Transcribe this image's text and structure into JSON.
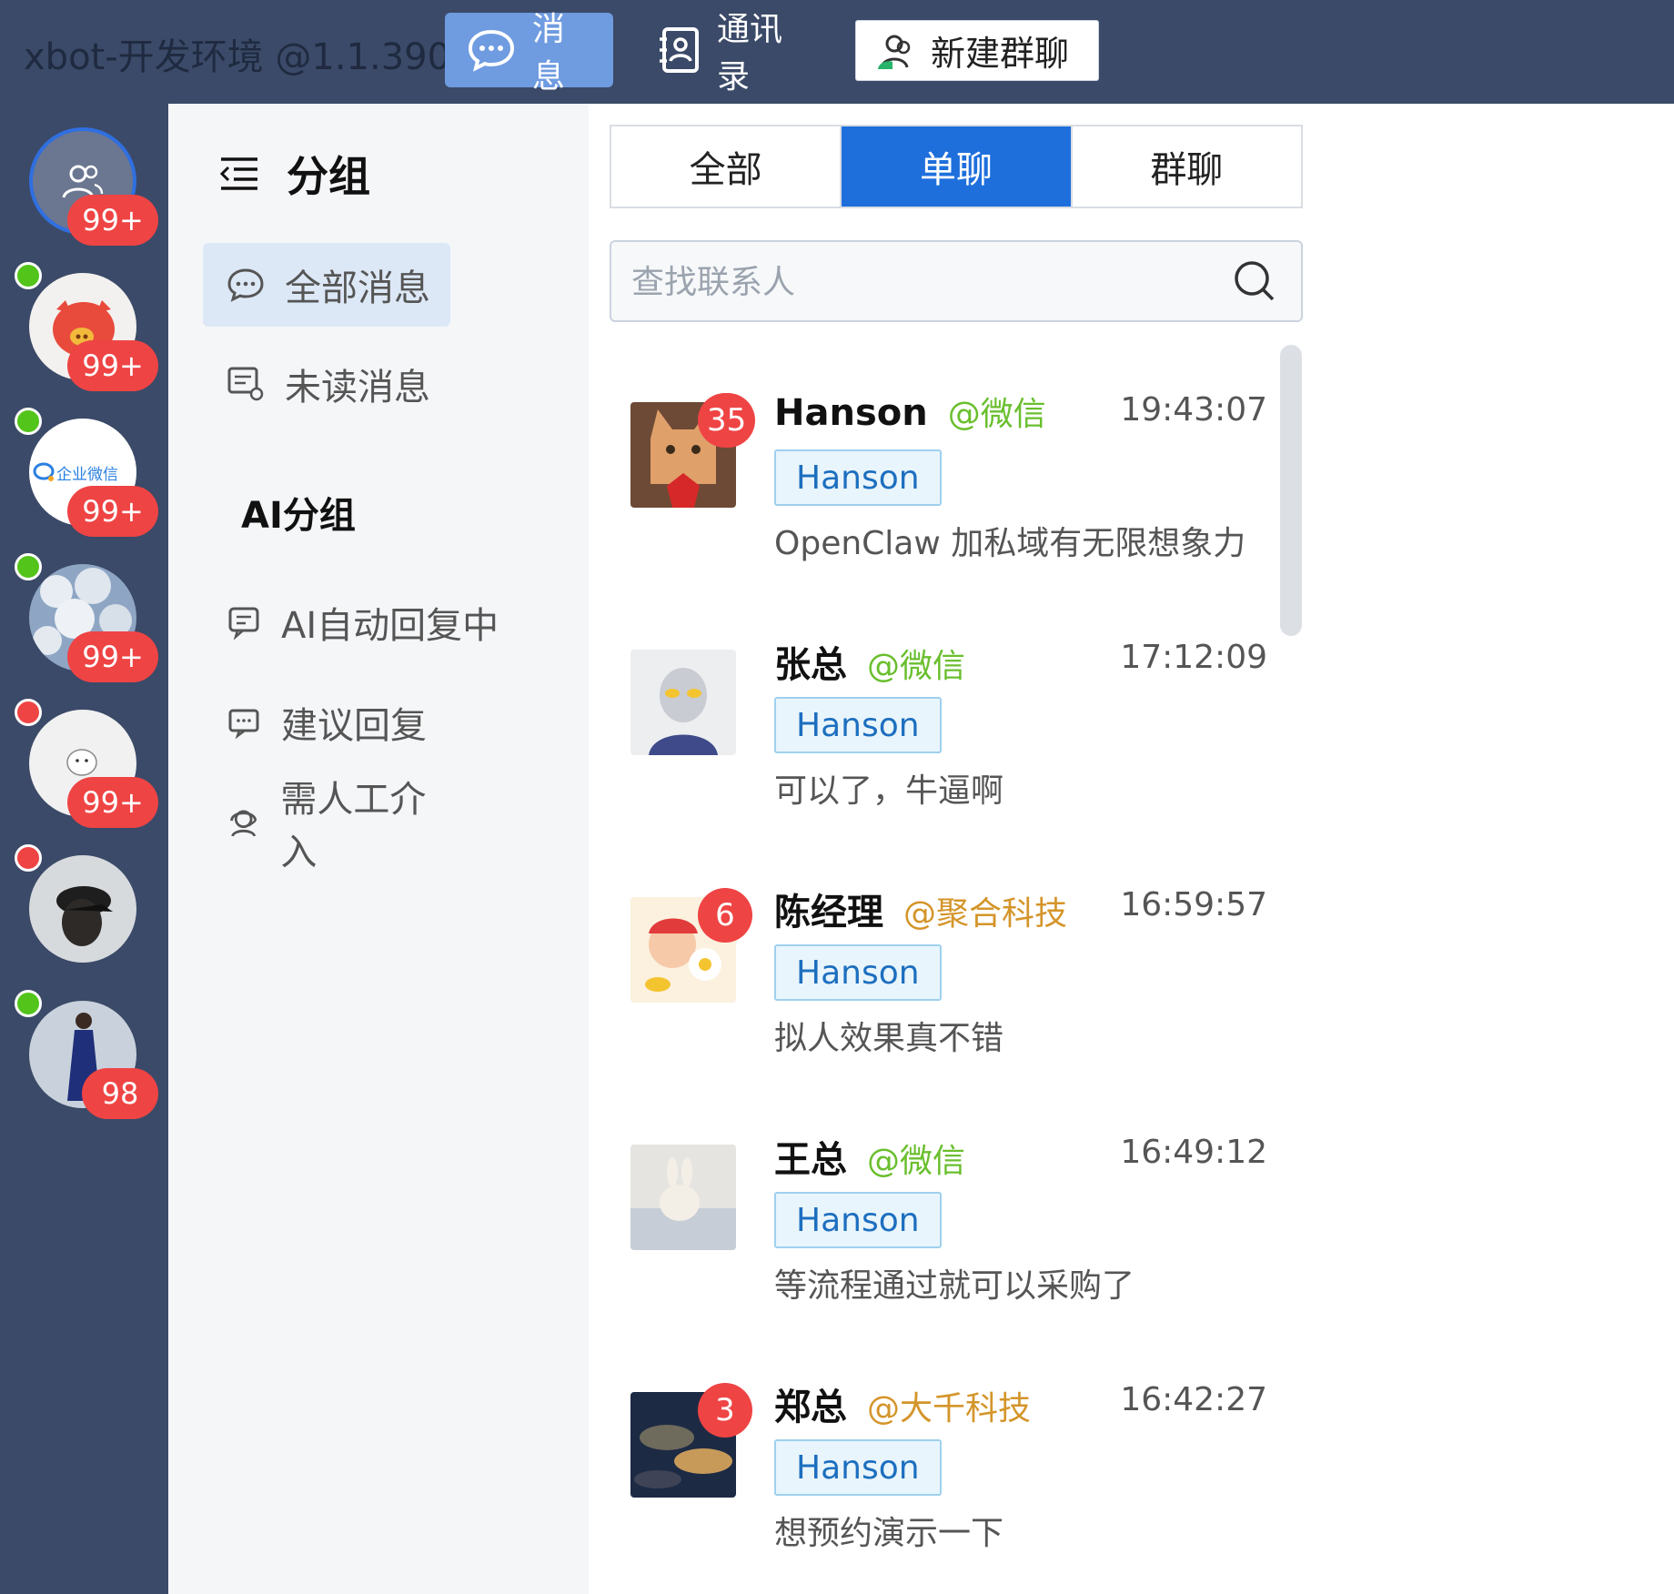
{
  "app": {
    "title": "xbot-开发环境 @1.1.390"
  },
  "nav": {
    "messages_label": "消息",
    "contacts_label": "通讯录",
    "new_group_label": "新建群聊"
  },
  "accounts": [
    {
      "badge": "99+",
      "status": "none"
    },
    {
      "badge": "99+",
      "status": "online"
    },
    {
      "badge": "99+",
      "status": "online",
      "logo_text": "企业微信"
    },
    {
      "badge": "99+",
      "status": "online"
    },
    {
      "badge": "99+",
      "status": "offline"
    },
    {
      "badge": "",
      "status": "offline"
    },
    {
      "badge": "98",
      "status": "online"
    }
  ],
  "groups": {
    "title": "分组",
    "items": [
      {
        "label": "全部消息",
        "icon": "chat-bubble-icon",
        "active": true
      },
      {
        "label": "未读消息",
        "icon": "unread-message-icon",
        "active": false
      }
    ],
    "ai_section_title": "AI分组",
    "ai_items": [
      {
        "label": "AI自动回复中",
        "icon": "auto-reply-icon"
      },
      {
        "label": "建议回复",
        "icon": "suggest-reply-icon"
      },
      {
        "label": "需人工介入",
        "icon": "agent-headset-icon"
      }
    ]
  },
  "chat_list": {
    "tabs": [
      {
        "label": "全部",
        "active": false
      },
      {
        "label": "单聊",
        "active": true
      },
      {
        "label": "群聊",
        "active": false
      }
    ],
    "search_placeholder": "查找联系人",
    "items": [
      {
        "name": "Hanson",
        "source": "@微信",
        "source_color": "#6abf2e",
        "time": "19:43:07",
        "tag": "Hanson",
        "preview": "OpenClaw 加私域有无限想象力",
        "unread": "35"
      },
      {
        "name": "张总",
        "source": "@微信",
        "source_color": "#6abf2e",
        "time": "17:12:09",
        "tag": "Hanson",
        "preview": "可以了，牛逼啊",
        "unread": ""
      },
      {
        "name": "陈经理",
        "source": "@聚合科技",
        "source_color": "#d4952a",
        "time": "16:59:57",
        "tag": "Hanson",
        "preview": "拟人效果真不错",
        "unread": "6"
      },
      {
        "name": "王总",
        "source": "@微信",
        "source_color": "#6abf2e",
        "time": "16:49:12",
        "tag": "Hanson",
        "preview": "等流程通过就可以采购了",
        "unread": ""
      },
      {
        "name": "郑总",
        "source": "@大千科技",
        "source_color": "#d4952a",
        "time": "16:42:27",
        "tag": "Hanson",
        "preview": "想预约演示一下",
        "unread": "3"
      }
    ]
  },
  "colors": {
    "topbar": "#3b4a68",
    "accent": "#1e6fdc",
    "online": "#52c41a",
    "offline": "#ef4444",
    "badge": "#ef4444"
  }
}
